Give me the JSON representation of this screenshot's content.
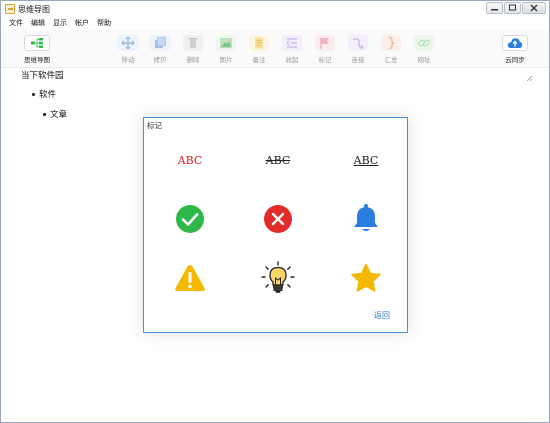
{
  "window": {
    "title": "思维导图",
    "controls": {
      "minimize": "0",
      "maximize": "1",
      "close": "r"
    }
  },
  "menu": [
    "文件",
    "编辑",
    "显示",
    "帐户",
    "帮助"
  ],
  "toolbar": {
    "mindmap_label": "思维导图",
    "items": [
      {
        "label": "移动",
        "icon": "move-icon"
      },
      {
        "label": "拷贝",
        "icon": "copy-icon"
      },
      {
        "label": "删除",
        "icon": "trash-icon"
      },
      {
        "label": "图片",
        "icon": "image-icon"
      },
      {
        "label": "备注",
        "icon": "note-icon"
      },
      {
        "label": "收起",
        "icon": "collapse-icon"
      },
      {
        "label": "标记",
        "icon": "flag-icon"
      },
      {
        "label": "连接",
        "icon": "connect-icon"
      },
      {
        "label": "汇总",
        "icon": "brace-icon"
      },
      {
        "label": "网址",
        "icon": "link-icon"
      }
    ],
    "cloud_label": "云同步",
    "colors": {
      "disabled_icon": "#c7b3e8",
      "cloud": "#2b7de0"
    }
  },
  "outline": {
    "root": "当下软件园",
    "items": [
      "软件",
      "文章"
    ]
  },
  "dialog": {
    "title": "标记",
    "marks": {
      "abc_red": "ABC",
      "abc_strike": "ABC",
      "abc_underline": "ABC"
    },
    "icons": [
      "check-circle-icon",
      "x-circle-icon",
      "bell-icon",
      "warning-icon",
      "lightbulb-icon",
      "star-icon"
    ],
    "back_label": "返回",
    "colors": {
      "check": "#2fb84a",
      "x": "#e22b2b",
      "bell": "#2b7de0",
      "warning": "#f5b800",
      "star": "#f5b800"
    }
  }
}
